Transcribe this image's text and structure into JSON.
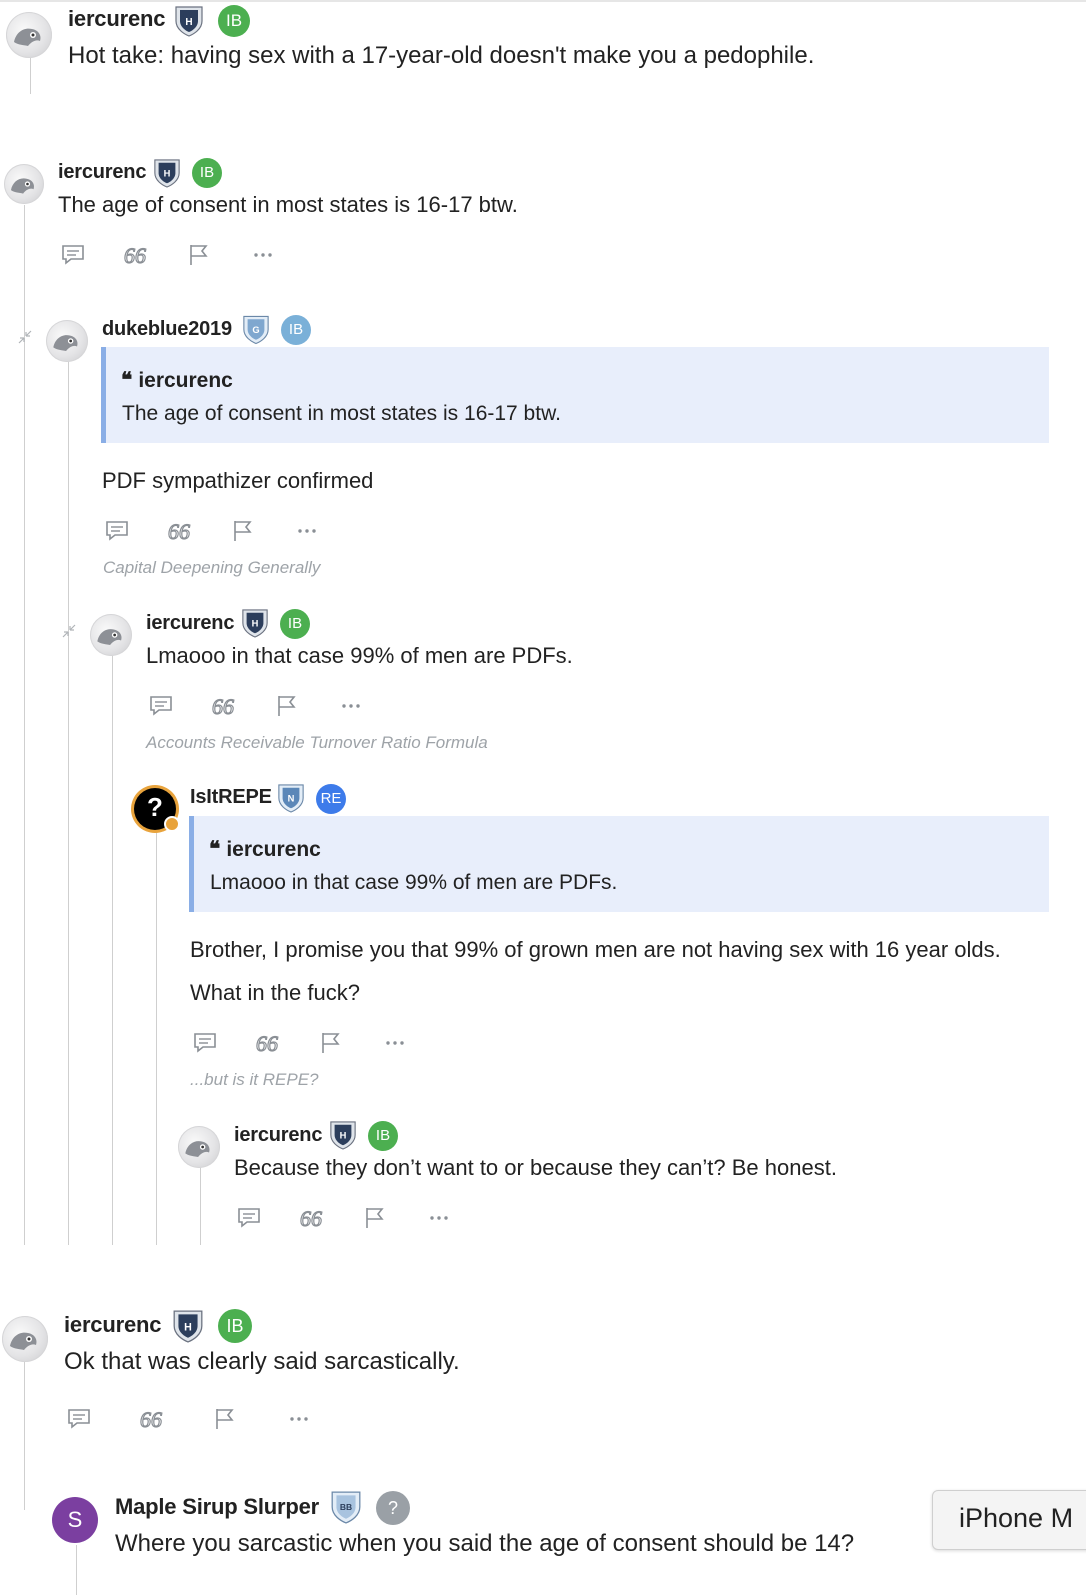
{
  "posts": [
    {
      "username": "iercurenc",
      "badge": "IB",
      "shield_letter": "H",
      "text": "Hot take: having sex with a 17-year-old doesn't make you a pedophile."
    },
    {
      "username": "iercurenc",
      "badge": "IB",
      "shield_letter": "H",
      "text": "The age of consent in most states is 16-17 btw."
    },
    {
      "username": "dukeblue2019",
      "badge": "IB",
      "shield_letter": "G",
      "quote_author": "iercurenc",
      "quote_text": "The age of consent in most states is 16-17 btw.",
      "text": "PDF sympathizer confirmed",
      "signature": "Capital Deepening Generally"
    },
    {
      "username": "iercurenc",
      "badge": "IB",
      "shield_letter": "H",
      "text": "Lmaooo in that case 99% of men are PDFs.",
      "signature": "Accounts Receivable Turnover Ratio Formula"
    },
    {
      "username": "IsItREPE",
      "badge": "RE",
      "shield_letter": "N",
      "avatar_glyph": "?",
      "quote_author": "iercurenc",
      "quote_text": "Lmaooo in that case 99% of men are PDFs.",
      "text_line1": "Brother, I promise you that 99% of grown men are not having sex with 16 year olds.",
      "text_line2": "What in the fuck?",
      "signature": "...but is it REPE?"
    },
    {
      "username": "iercurenc",
      "badge": "IB",
      "shield_letter": "H",
      "text": "Because they don’t want to or because they can’t? Be honest."
    },
    {
      "username": "iercurenc",
      "badge": "IB",
      "shield_letter": "H",
      "text": "Ok that was clearly said sarcastically."
    },
    {
      "username": "Maple Sirup Slurper",
      "badge": "?",
      "shield_letter": "BB",
      "avatar_letter": "S",
      "text": "Where you sarcastic when you said the age of consent should be 14?"
    }
  ],
  "quote_glyph": "66",
  "tooltip": {
    "text": "iPhone M"
  },
  "icons": {
    "reply": "comment-icon",
    "quote": "quote-icon",
    "flag": "flag-icon",
    "more": "more-icon",
    "collapse": "collapse-icon",
    "shield": "shield-icon"
  },
  "colors": {
    "ib_badge": "#4caf50",
    "ib_badge_light": "#7ab0d8",
    "re_badge": "#3d7bea",
    "quote_bg": "#e8eefb",
    "quote_border": "#8aaee6",
    "signature": "#9ea3a8",
    "maple_avatar": "#7b3fa0"
  }
}
